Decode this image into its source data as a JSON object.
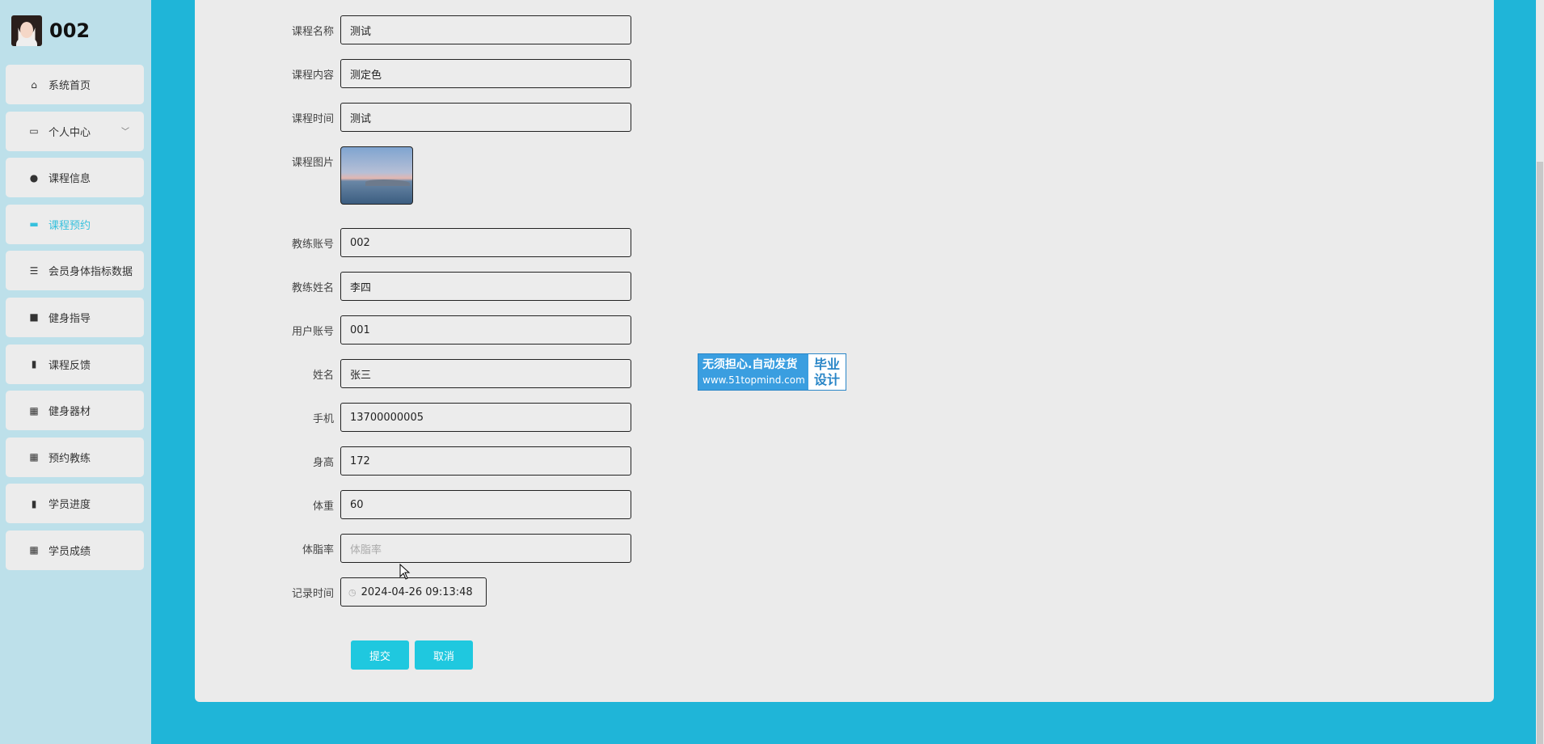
{
  "user": {
    "name": "002"
  },
  "menu": [
    {
      "label": "系统首页",
      "icon": "home-icon",
      "glyph": "⌂"
    },
    {
      "label": "个人中心",
      "icon": "wallet-icon",
      "glyph": "▭",
      "chevron": "﹀"
    },
    {
      "label": "课程信息",
      "icon": "location-icon",
      "glyph": "●"
    },
    {
      "label": "课程预约",
      "icon": "briefcase-icon",
      "glyph": "▬",
      "active": true
    },
    {
      "label": "会员身体指标数据",
      "icon": "list-icon",
      "glyph": "☰"
    },
    {
      "label": "健身指导",
      "icon": "wallet-filled-icon",
      "glyph": "■"
    },
    {
      "label": "课程反馈",
      "icon": "clipboard-icon",
      "glyph": "▮"
    },
    {
      "label": "健身器材",
      "icon": "grid-icon",
      "glyph": "▦"
    },
    {
      "label": "预约教练",
      "icon": "grid-icon",
      "glyph": "▦"
    },
    {
      "label": "学员进度",
      "icon": "clipboard-icon",
      "glyph": "▮"
    },
    {
      "label": "学员成绩",
      "icon": "grid-icon",
      "glyph": "▦"
    }
  ],
  "form": {
    "course_name": {
      "label": "课程名称",
      "value": "测试"
    },
    "course_content": {
      "label": "课程内容",
      "value": "测定色"
    },
    "course_time": {
      "label": "课程时间",
      "value": "测试"
    },
    "course_image": {
      "label": "课程图片"
    },
    "coach_account": {
      "label": "教练账号",
      "value": "002"
    },
    "coach_name": {
      "label": "教练姓名",
      "value": "李四"
    },
    "user_account": {
      "label": "用户账号",
      "value": "001"
    },
    "name": {
      "label": "姓名",
      "value": "张三"
    },
    "phone": {
      "label": "手机",
      "value": "13700000005"
    },
    "height": {
      "label": "身高",
      "value": "172"
    },
    "weight": {
      "label": "体重",
      "value": "60"
    },
    "body_fat": {
      "label": "体脂率",
      "placeholder": "体脂率",
      "value": ""
    },
    "record_time": {
      "label": "记录时间",
      "value": "2024-04-26 09:13:48"
    }
  },
  "buttons": {
    "submit": "提交",
    "cancel": "取消"
  },
  "badge": {
    "line1": "无须担心.自动发货",
    "line2": "www.51topmind.com",
    "right1": "毕业",
    "right2": "设计"
  },
  "colors": {
    "accent": "#1fc8df",
    "background": "#1fb5d8",
    "sidebar": "#bde0ea"
  }
}
